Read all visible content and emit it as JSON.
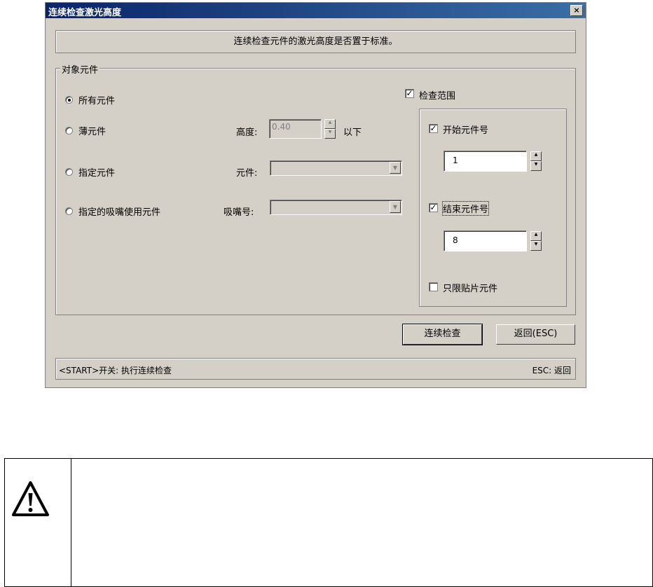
{
  "dialog": {
    "title": "连续检查激光高度",
    "close_label": "×",
    "message": "连续检查元件的激光高度是否置于标准。"
  },
  "target_group": {
    "legend": "对象元件",
    "options": [
      {
        "label": "所有元件",
        "selected": true
      },
      {
        "label": "薄元件",
        "selected": false
      },
      {
        "label": "指定元件",
        "selected": false
      },
      {
        "label": "指定的吸嘴使用元件",
        "selected": false
      }
    ],
    "height_label": "高度:",
    "height_value": "0.40",
    "height_suffix": "以下",
    "component_label": "元件:",
    "component_value": "",
    "nozzle_label": "吸嘴号:",
    "nozzle_value": ""
  },
  "range": {
    "enable_label": "检查范围",
    "enable_checked": true,
    "start_label": "开始元件号",
    "start_checked": true,
    "start_value": "1",
    "end_label": "结束元件号",
    "end_checked": true,
    "end_value": "8",
    "smd_only_label": "只限贴片元件",
    "smd_only_checked": false
  },
  "buttons": {
    "check_label": "连续检查",
    "back_label": "返回(ESC)"
  },
  "status": {
    "left": "<START>开关: 执行连续检查",
    "right": "ESC: 返回"
  },
  "note": {
    "icon": "warning-icon"
  }
}
